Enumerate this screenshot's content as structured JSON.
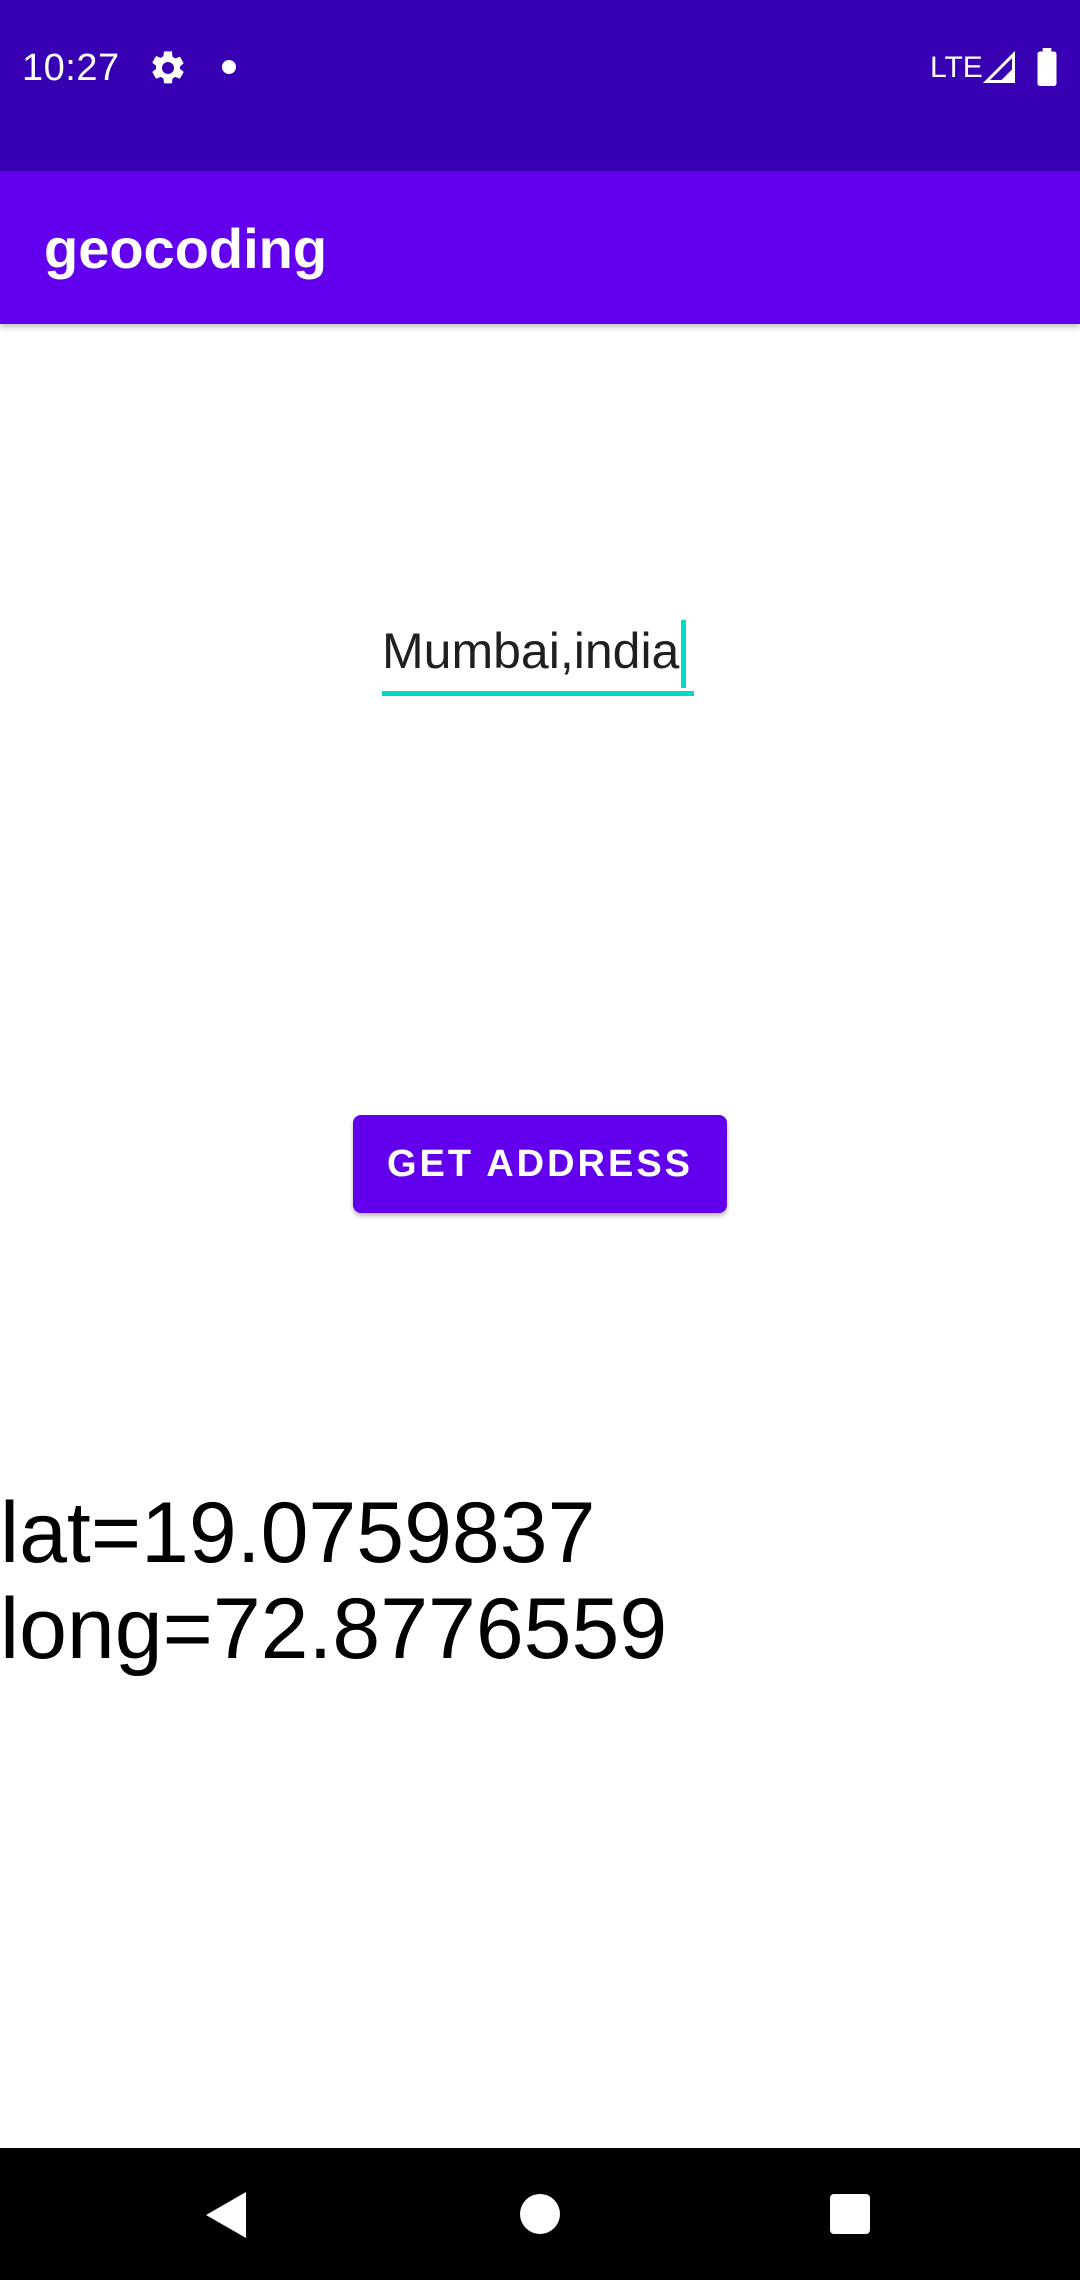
{
  "status_bar": {
    "time": "10:27",
    "network": "LTE",
    "icons": [
      "gear-icon",
      "notification-dot-icon",
      "signal-icon",
      "battery-icon"
    ],
    "background": "#3700B3"
  },
  "app_bar": {
    "title": "geocoding",
    "background": "#6200EE"
  },
  "address_input": {
    "value": "Mumbai,india",
    "accent": "#03DAC5"
  },
  "get_address_button": {
    "label": "GET ADDRESS",
    "background": "#6200EE"
  },
  "result": {
    "lat_line": "lat=19.0759837",
    "long_line": "long=72.8776559"
  },
  "nav_bar": {
    "icons": [
      "back-icon",
      "home-icon",
      "recents-icon"
    ]
  }
}
